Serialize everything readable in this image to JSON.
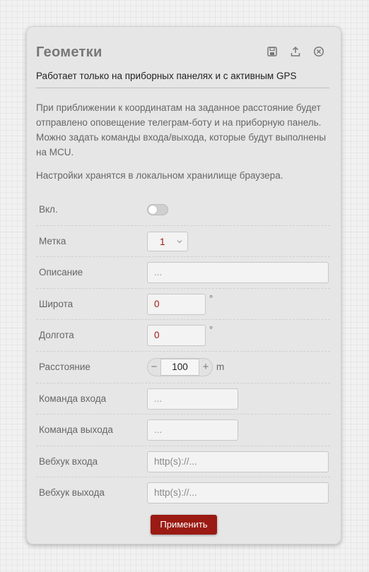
{
  "panel": {
    "title": "Геометки",
    "subtitle": "Работает только на приборных панелях и с активным GPS",
    "description": "При приближении к координатам на заданное расстояние будет отправлено оповещение телеграм-боту и на приборную панель. Можно задать команды входа/выхода, которые будут выполнены на MCU.",
    "storage_note": "Настройки хранятся в локальном хранилище браузера.",
    "icons": [
      "save-icon",
      "upload-icon",
      "close-circle-icon"
    ]
  },
  "form": {
    "enabled": {
      "label": "Вкл.",
      "value": false
    },
    "marker": {
      "label": "Метка",
      "value": "1"
    },
    "description": {
      "label": "Описание",
      "placeholder": "..."
    },
    "latitude": {
      "label": "Широта",
      "value": "0",
      "unit": "°"
    },
    "longitude": {
      "label": "Долгота",
      "value": "0",
      "unit": "°"
    },
    "distance": {
      "label": "Расстояние",
      "value": "100",
      "minus": "−",
      "plus": "+",
      "unit": "m"
    },
    "enter_command": {
      "label": "Команда входа",
      "placeholder": "..."
    },
    "exit_command": {
      "label": "Команда выхода",
      "placeholder": "..."
    },
    "enter_webhook": {
      "label": "Вебхук входа",
      "placeholder": "http(s)://..."
    },
    "exit_webhook": {
      "label": "Вебхук выхода",
      "placeholder": "http(s)://..."
    }
  },
  "actions": {
    "apply_label": "Применить"
  },
  "colors": {
    "accent": "#9b1a14",
    "value_red": "#a01a14",
    "panel_bg": "#e6e6e6"
  }
}
